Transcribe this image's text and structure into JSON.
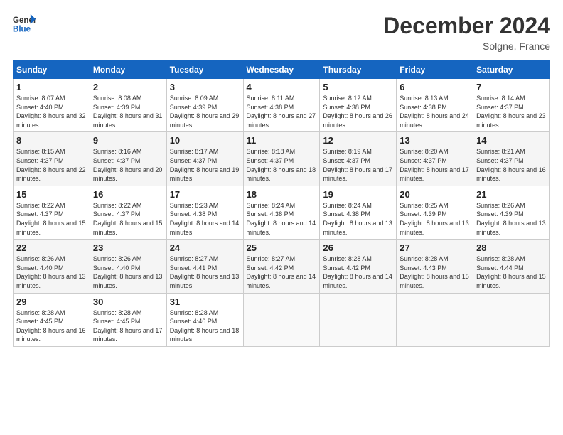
{
  "header": {
    "logo_line1": "General",
    "logo_line2": "Blue",
    "month": "December 2024",
    "location": "Solgne, France"
  },
  "weekdays": [
    "Sunday",
    "Monday",
    "Tuesday",
    "Wednesday",
    "Thursday",
    "Friday",
    "Saturday"
  ],
  "weeks": [
    [
      {
        "day": "1",
        "sunrise": "8:07 AM",
        "sunset": "4:40 PM",
        "daylight": "8 hours and 32 minutes."
      },
      {
        "day": "2",
        "sunrise": "8:08 AM",
        "sunset": "4:39 PM",
        "daylight": "8 hours and 31 minutes."
      },
      {
        "day": "3",
        "sunrise": "8:09 AM",
        "sunset": "4:39 PM",
        "daylight": "8 hours and 29 minutes."
      },
      {
        "day": "4",
        "sunrise": "8:11 AM",
        "sunset": "4:38 PM",
        "daylight": "8 hours and 27 minutes."
      },
      {
        "day": "5",
        "sunrise": "8:12 AM",
        "sunset": "4:38 PM",
        "daylight": "8 hours and 26 minutes."
      },
      {
        "day": "6",
        "sunrise": "8:13 AM",
        "sunset": "4:38 PM",
        "daylight": "8 hours and 24 minutes."
      },
      {
        "day": "7",
        "sunrise": "8:14 AM",
        "sunset": "4:37 PM",
        "daylight": "8 hours and 23 minutes."
      }
    ],
    [
      {
        "day": "8",
        "sunrise": "8:15 AM",
        "sunset": "4:37 PM",
        "daylight": "8 hours and 22 minutes."
      },
      {
        "day": "9",
        "sunrise": "8:16 AM",
        "sunset": "4:37 PM",
        "daylight": "8 hours and 20 minutes."
      },
      {
        "day": "10",
        "sunrise": "8:17 AM",
        "sunset": "4:37 PM",
        "daylight": "8 hours and 19 minutes."
      },
      {
        "day": "11",
        "sunrise": "8:18 AM",
        "sunset": "4:37 PM",
        "daylight": "8 hours and 18 minutes."
      },
      {
        "day": "12",
        "sunrise": "8:19 AM",
        "sunset": "4:37 PM",
        "daylight": "8 hours and 17 minutes."
      },
      {
        "day": "13",
        "sunrise": "8:20 AM",
        "sunset": "4:37 PM",
        "daylight": "8 hours and 17 minutes."
      },
      {
        "day": "14",
        "sunrise": "8:21 AM",
        "sunset": "4:37 PM",
        "daylight": "8 hours and 16 minutes."
      }
    ],
    [
      {
        "day": "15",
        "sunrise": "8:22 AM",
        "sunset": "4:37 PM",
        "daylight": "8 hours and 15 minutes."
      },
      {
        "day": "16",
        "sunrise": "8:22 AM",
        "sunset": "4:37 PM",
        "daylight": "8 hours and 15 minutes."
      },
      {
        "day": "17",
        "sunrise": "8:23 AM",
        "sunset": "4:38 PM",
        "daylight": "8 hours and 14 minutes."
      },
      {
        "day": "18",
        "sunrise": "8:24 AM",
        "sunset": "4:38 PM",
        "daylight": "8 hours and 14 minutes."
      },
      {
        "day": "19",
        "sunrise": "8:24 AM",
        "sunset": "4:38 PM",
        "daylight": "8 hours and 13 minutes."
      },
      {
        "day": "20",
        "sunrise": "8:25 AM",
        "sunset": "4:39 PM",
        "daylight": "8 hours and 13 minutes."
      },
      {
        "day": "21",
        "sunrise": "8:26 AM",
        "sunset": "4:39 PM",
        "daylight": "8 hours and 13 minutes."
      }
    ],
    [
      {
        "day": "22",
        "sunrise": "8:26 AM",
        "sunset": "4:40 PM",
        "daylight": "8 hours and 13 minutes."
      },
      {
        "day": "23",
        "sunrise": "8:26 AM",
        "sunset": "4:40 PM",
        "daylight": "8 hours and 13 minutes."
      },
      {
        "day": "24",
        "sunrise": "8:27 AM",
        "sunset": "4:41 PM",
        "daylight": "8 hours and 13 minutes."
      },
      {
        "day": "25",
        "sunrise": "8:27 AM",
        "sunset": "4:42 PM",
        "daylight": "8 hours and 14 minutes."
      },
      {
        "day": "26",
        "sunrise": "8:28 AM",
        "sunset": "4:42 PM",
        "daylight": "8 hours and 14 minutes."
      },
      {
        "day": "27",
        "sunrise": "8:28 AM",
        "sunset": "4:43 PM",
        "daylight": "8 hours and 15 minutes."
      },
      {
        "day": "28",
        "sunrise": "8:28 AM",
        "sunset": "4:44 PM",
        "daylight": "8 hours and 15 minutes."
      }
    ],
    [
      {
        "day": "29",
        "sunrise": "8:28 AM",
        "sunset": "4:45 PM",
        "daylight": "8 hours and 16 minutes."
      },
      {
        "day": "30",
        "sunrise": "8:28 AM",
        "sunset": "4:45 PM",
        "daylight": "8 hours and 17 minutes."
      },
      {
        "day": "31",
        "sunrise": "8:28 AM",
        "sunset": "4:46 PM",
        "daylight": "8 hours and 18 minutes."
      },
      null,
      null,
      null,
      null
    ]
  ]
}
